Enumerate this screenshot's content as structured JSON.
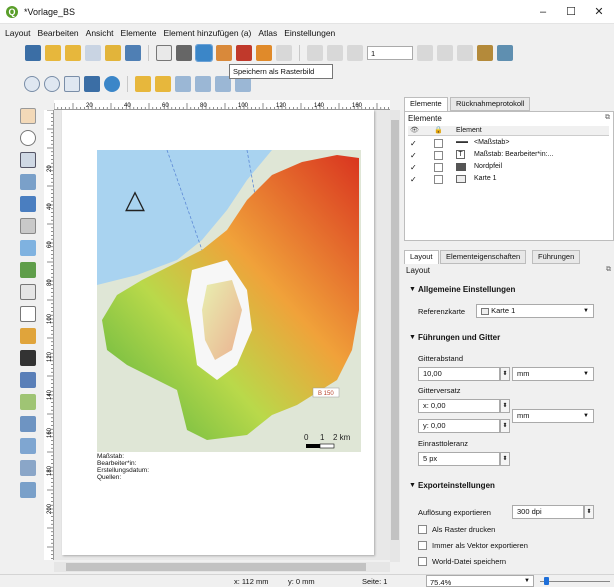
{
  "window": {
    "title": "*Vorlage_BS",
    "minimize": "–",
    "maximize": "☐",
    "close": "✕"
  },
  "menu": [
    "Layout",
    "Bearbeiten",
    "Ansicht",
    "Elemente",
    "Element hinzufügen (a)",
    "Atlas",
    "Einstellungen"
  ],
  "toolbar": {
    "atlas_page": "1",
    "tooltip": "Speichern als Rasterbild"
  },
  "ruler_h_ticks": [
    "20",
    "40",
    "60",
    "80",
    "100",
    "120",
    "140",
    "160"
  ],
  "ruler_v_ticks": [
    "20",
    "40",
    "60",
    "80",
    "100",
    "120",
    "140",
    "160",
    "180",
    "200"
  ],
  "map": {
    "north_arrow": "△",
    "road_label": "B 150",
    "scale": {
      "zero": "0",
      "mid": "1",
      "end": "2 km"
    }
  },
  "page_labels": [
    "Maßstab:",
    "Bearbeiter*in:",
    "Erstellungsdatum:",
    "Quellen:"
  ],
  "status": {
    "x": "x: 112 mm",
    "y": "y: 0 mm",
    "page": "Seite: 1",
    "zoom": "75.4%"
  },
  "panel_top": {
    "tabs": [
      "Elemente",
      "Rücknahmeprotokoll"
    ],
    "header": "Elemente",
    "col_item": "Element",
    "items": [
      {
        "label": "<Maßstab>",
        "visible": true,
        "locked": false
      },
      {
        "label": "Maßstab: Bearbeiter*in:...",
        "visible": true,
        "locked": false
      },
      {
        "label": "Nordpfeil",
        "visible": true,
        "locked": false
      },
      {
        "label": "Karte 1",
        "visible": true,
        "locked": false
      }
    ]
  },
  "panel_bottom": {
    "tabs": [
      "Layout",
      "Elementeigenschaften",
      "Führungen"
    ],
    "header": "Layout",
    "sec_general": "Allgemeine Einstellungen",
    "ref_map_label": "Referenzkarte",
    "ref_map_value": "Karte 1",
    "sec_guides": "Führungen und Gitter",
    "grid_spacing_label": "Gitterabstand",
    "grid_spacing_value": "10,00",
    "grid_spacing_unit": "mm",
    "grid_offset_label": "Gitterversatz",
    "grid_offset_x": "x: 0,00",
    "grid_offset_y": "y: 0,00",
    "grid_offset_unit": "mm",
    "snap_label": "Einrasttoleranz",
    "snap_value": "5 px",
    "sec_export": "Exporteinstellungen",
    "export_res_label": "Auflösung exportieren",
    "export_res_value": "300 dpi",
    "print_raster": "Als Raster drucken",
    "always_vector": "Immer als Vektor exportieren",
    "world_file": "World-Datei speichern"
  }
}
